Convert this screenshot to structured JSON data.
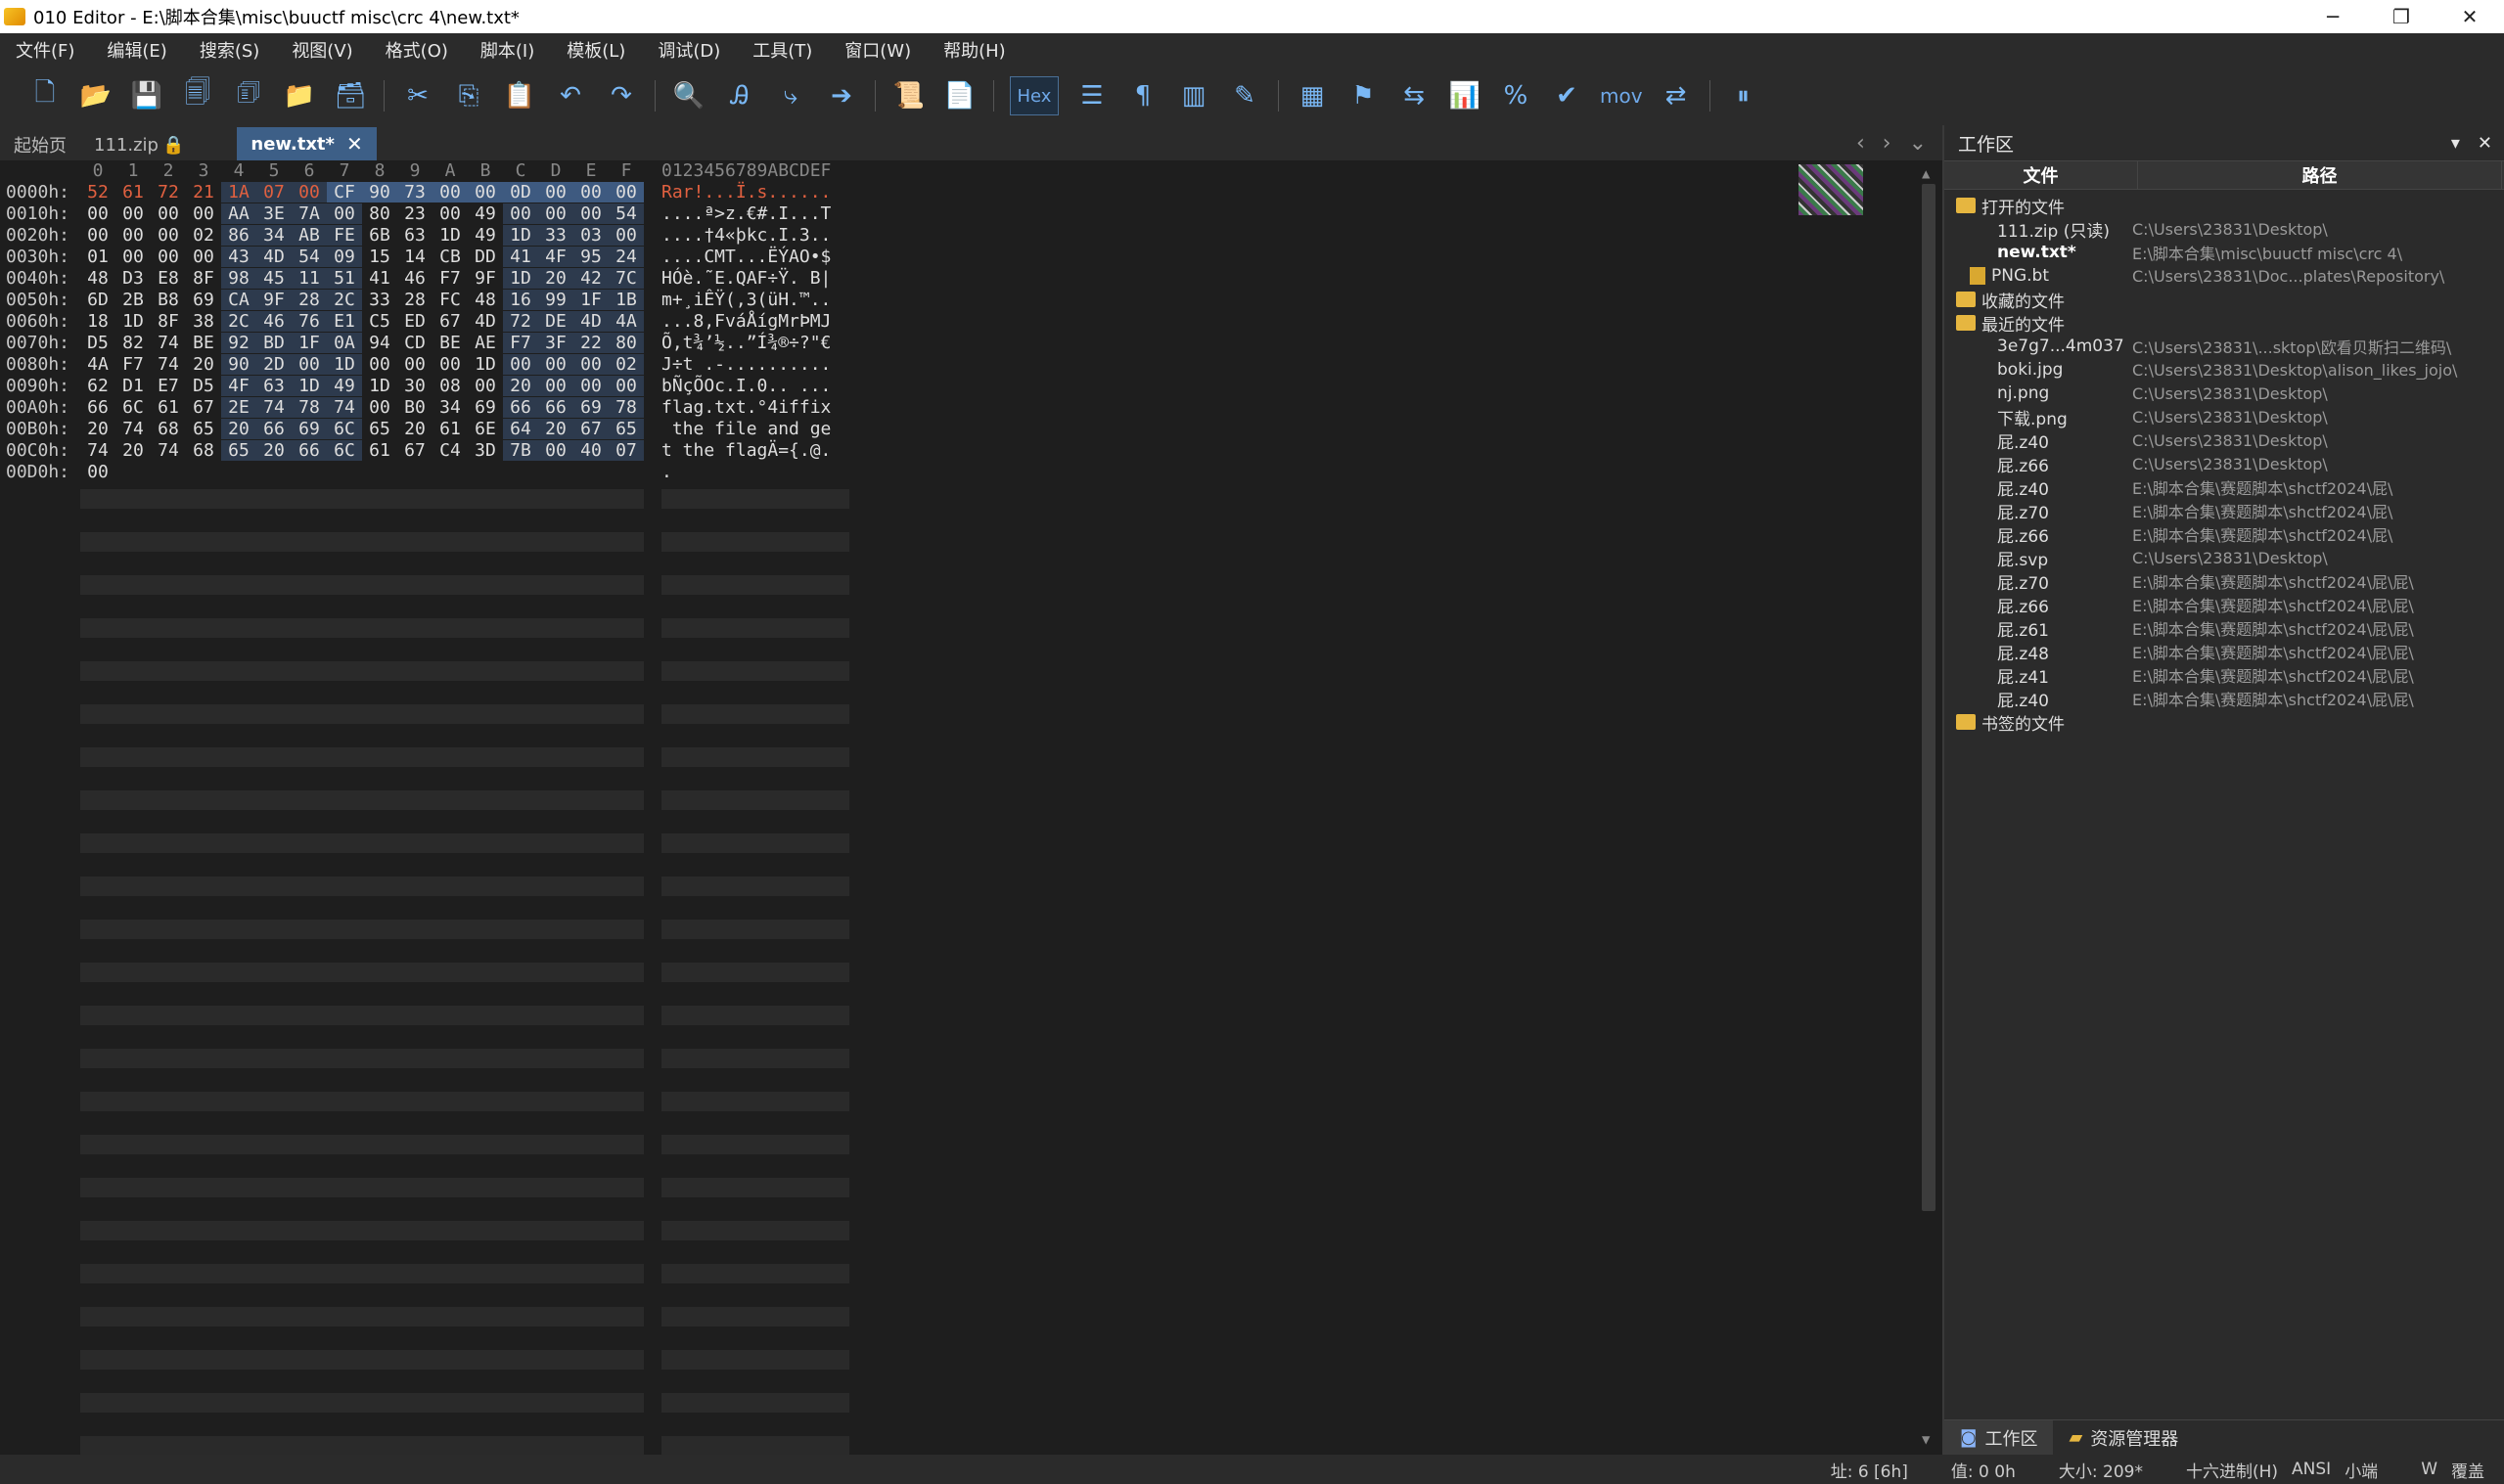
{
  "window": {
    "title": "010 Editor - E:\\脚本合集\\misc\\buuctf misc\\crc 4\\new.txt*",
    "buttons": [
      "─",
      "❐",
      "✕"
    ]
  },
  "menu": [
    "文件(F)",
    "编辑(E)",
    "搜索(S)",
    "视图(V)",
    "格式(O)",
    "脚本(I)",
    "模板(L)",
    "调试(D)",
    "工具(T)",
    "窗口(W)",
    "帮助(H)"
  ],
  "toolbar": {
    "hex_label": "Hex",
    "mov_label": "mov",
    "icons": [
      "new-file-icon",
      "open-icon",
      "save-icon",
      "save-as-icon",
      "save-all-icon",
      "open-folder-icon",
      "close-icon",
      "cut-icon",
      "copy-icon",
      "paste-icon",
      "undo-icon",
      "redo-icon",
      "find-icon",
      "replace-icon",
      "goto-icon",
      "jump-icon",
      "template-icon",
      "script-icon",
      "hex-toggle",
      "text-icon",
      "paragraph-icon",
      "columns-icon",
      "highlight-icon",
      "calculator-icon",
      "inspector-icon",
      "compare-icon",
      "histogram-icon",
      "percent-icon",
      "checksum-icon",
      "mov-icon",
      "base-convert-icon",
      "pause-icon"
    ]
  },
  "tabs": [
    {
      "label": "起始页"
    },
    {
      "label": "111.zip"
    },
    {
      "label": "new.txt*"
    }
  ],
  "editor": {
    "header_hex": [
      "0",
      "1",
      "2",
      "3",
      "4",
      "5",
      "6",
      "7",
      "8",
      "9",
      "A",
      "B",
      "C",
      "D",
      "E",
      "F"
    ],
    "header_ascii": "0123456789ABCDEF",
    "rows": [
      {
        "addr": "0000h:",
        "hex": [
          "52",
          "61",
          "72",
          "21",
          "1A",
          "07",
          "00",
          "CF",
          "90",
          "73",
          "00",
          "00",
          "0D",
          "00",
          "00",
          "00"
        ],
        "ascii": "Rar!...Ï.s......"
      },
      {
        "addr": "0010h:",
        "hex": [
          "00",
          "00",
          "00",
          "00",
          "AA",
          "3E",
          "7A",
          "00",
          "80",
          "23",
          "00",
          "49",
          "00",
          "00",
          "00",
          "54"
        ],
        "ascii": "....ª>z.€#.I...T"
      },
      {
        "addr": "0020h:",
        "hex": [
          "00",
          "00",
          "00",
          "02",
          "86",
          "34",
          "AB",
          "FE",
          "6B",
          "63",
          "1D",
          "49",
          "1D",
          "33",
          "03",
          "00"
        ],
        "ascii": "....†4«þkc.I.3.."
      },
      {
        "addr": "0030h:",
        "hex": [
          "01",
          "00",
          "00",
          "00",
          "43",
          "4D",
          "54",
          "09",
          "15",
          "14",
          "CB",
          "DD",
          "41",
          "4F",
          "95",
          "24"
        ],
        "ascii": "....CMT...ËÝAO•$"
      },
      {
        "addr": "0040h:",
        "hex": [
          "48",
          "D3",
          "E8",
          "8F",
          "98",
          "45",
          "11",
          "51",
          "41",
          "46",
          "F7",
          "9F",
          "1D",
          "20",
          "42",
          "7C"
        ],
        "ascii": "HÓè.˜E.QAF÷Ÿ. B|"
      },
      {
        "addr": "0050h:",
        "hex": [
          "6D",
          "2B",
          "B8",
          "69",
          "CA",
          "9F",
          "28",
          "2C",
          "33",
          "28",
          "FC",
          "48",
          "16",
          "99",
          "1F",
          "1B"
        ],
        "ascii": "m+¸iÊŸ(,3(üH.™.."
      },
      {
        "addr": "0060h:",
        "hex": [
          "18",
          "1D",
          "8F",
          "38",
          "2C",
          "46",
          "76",
          "E1",
          "C5",
          "ED",
          "67",
          "4D",
          "72",
          "DE",
          "4D",
          "4A"
        ],
        "ascii": "...8,FváÅígMrÞMJ"
      },
      {
        "addr": "0070h:",
        "hex": [
          "D5",
          "82",
          "74",
          "BE",
          "92",
          "BD",
          "1F",
          "0A",
          "94",
          "CD",
          "BE",
          "AE",
          "F7",
          "3F",
          "22",
          "80"
        ],
        "ascii": "Õ‚t¾’½..”Í¾®÷?\"€"
      },
      {
        "addr": "0080h:",
        "hex": [
          "4A",
          "F7",
          "74",
          "20",
          "90",
          "2D",
          "00",
          "1D",
          "00",
          "00",
          "00",
          "1D",
          "00",
          "00",
          "00",
          "02"
        ],
        "ascii": "J÷t .-.........."
      },
      {
        "addr": "0090h:",
        "hex": [
          "62",
          "D1",
          "E7",
          "D5",
          "4F",
          "63",
          "1D",
          "49",
          "1D",
          "30",
          "08",
          "00",
          "20",
          "00",
          "00",
          "00"
        ],
        "ascii": "bÑçÕOc.I.0.. ..."
      },
      {
        "addr": "00A0h:",
        "hex": [
          "66",
          "6C",
          "61",
          "67",
          "2E",
          "74",
          "78",
          "74",
          "00",
          "B0",
          "34",
          "69",
          "66",
          "66",
          "69",
          "78"
        ],
        "ascii": "flag.txt.°4iffix"
      },
      {
        "addr": "00B0h:",
        "hex": [
          "20",
          "74",
          "68",
          "65",
          "20",
          "66",
          "69",
          "6C",
          "65",
          "20",
          "61",
          "6E",
          "64",
          "20",
          "67",
          "65"
        ],
        "ascii": " the file and ge"
      },
      {
        "addr": "00C0h:",
        "hex": [
          "74",
          "20",
          "74",
          "68",
          "65",
          "20",
          "66",
          "6C",
          "61",
          "67",
          "C4",
          "3D",
          "7B",
          "00",
          "40",
          "07"
        ],
        "ascii": "t the flagÄ={.@."
      },
      {
        "addr": "00D0h:",
        "hex": [
          "00"
        ],
        "ascii": "."
      }
    ]
  },
  "workspace": {
    "title": "工作区",
    "col_file": "文件",
    "col_path": "路径",
    "open_files_label": "打开的文件",
    "open_files": [
      {
        "name": "111.zip (只读)",
        "path": "C:\\Users\\23831\\Desktop\\"
      },
      {
        "name": "new.txt*",
        "path": "E:\\脚本合集\\misc\\buuctf misc\\crc 4\\"
      },
      {
        "name": "PNG.bt",
        "path": "C:\\Users\\23831\\Doc...plates\\Repository\\"
      }
    ],
    "favorites_label": "收藏的文件",
    "recent_label": "最近的文件",
    "recent_files": [
      {
        "name": "3e7g7...4m037",
        "path": "C:\\Users\\23831\\...sktop\\欧看贝斯扫二维码\\"
      },
      {
        "name": "boki.jpg",
        "path": "C:\\Users\\23831\\Desktop\\alison_likes_jojo\\"
      },
      {
        "name": "nj.png",
        "path": "C:\\Users\\23831\\Desktop\\"
      },
      {
        "name": "下载.png",
        "path": "C:\\Users\\23831\\Desktop\\"
      },
      {
        "name": "屁.z40",
        "path": "C:\\Users\\23831\\Desktop\\"
      },
      {
        "name": "屁.z66",
        "path": "C:\\Users\\23831\\Desktop\\"
      },
      {
        "name": "屁.z40",
        "path": "E:\\脚本合集\\赛题脚本\\shctf2024\\屁\\"
      },
      {
        "name": "屁.z70",
        "path": "E:\\脚本合集\\赛题脚本\\shctf2024\\屁\\"
      },
      {
        "name": "屁.z66",
        "path": "E:\\脚本合集\\赛题脚本\\shctf2024\\屁\\"
      },
      {
        "name": "屁.svp",
        "path": "C:\\Users\\23831\\Desktop\\"
      },
      {
        "name": "屁.z70",
        "path": "E:\\脚本合集\\赛题脚本\\shctf2024\\屁\\屁\\"
      },
      {
        "name": "屁.z66",
        "path": "E:\\脚本合集\\赛题脚本\\shctf2024\\屁\\屁\\"
      },
      {
        "name": "屁.z61",
        "path": "E:\\脚本合集\\赛题脚本\\shctf2024\\屁\\屁\\"
      },
      {
        "name": "屁.z48",
        "path": "E:\\脚本合集\\赛题脚本\\shctf2024\\屁\\屁\\"
      },
      {
        "name": "屁.z41",
        "path": "E:\\脚本合集\\赛题脚本\\shctf2024\\屁\\屁\\"
      },
      {
        "name": "屁.z40",
        "path": "E:\\脚本合集\\赛题脚本\\shctf2024\\屁\\屁\\"
      }
    ],
    "bookmarks_label": "书签的文件",
    "tab_workspace": "工作区",
    "tab_explorer": "资源管理器"
  },
  "status": {
    "address": "址: 6 [6h]",
    "value": "值: 0 0h",
    "size": "大小: 209*",
    "mode": "十六进制(H)",
    "encoding": "ANSI",
    "endian": "小端",
    "write": "W",
    "overwrite": "覆盖"
  }
}
